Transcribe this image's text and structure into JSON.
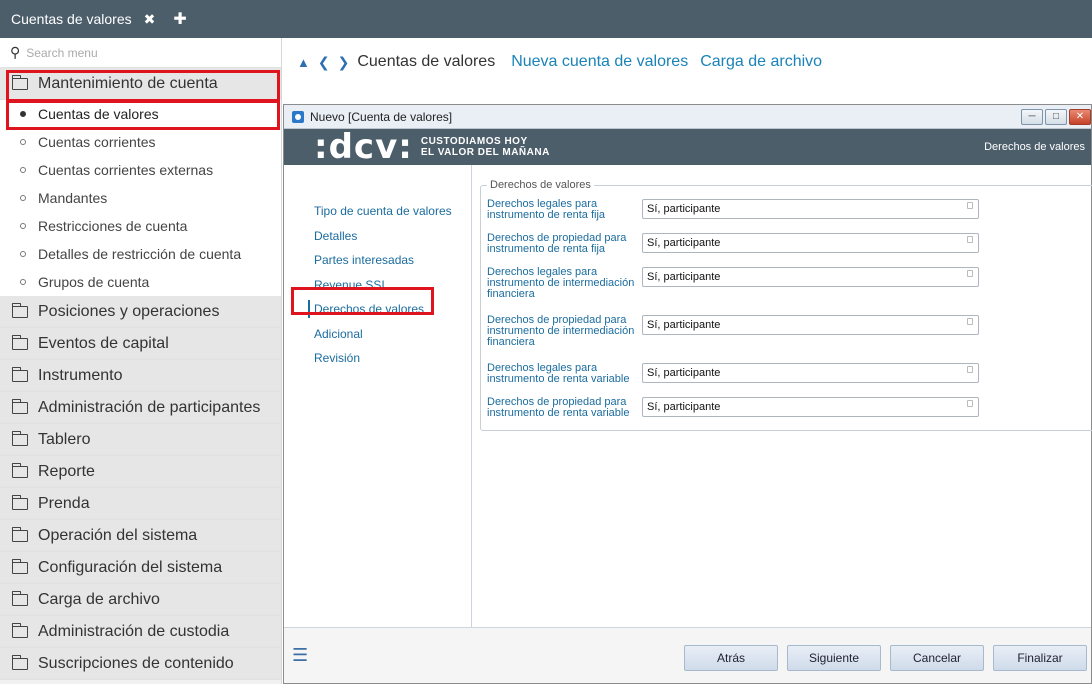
{
  "tabbar": {
    "tab_label": "Cuentas de valores",
    "close_glyph": "✖",
    "add_glyph": "✚"
  },
  "sidebar": {
    "search_placeholder": "Search menu",
    "sections": [
      {
        "label": "Mantenimiento de cuenta",
        "expanded": true
      },
      {
        "label": "Posiciones y operaciones"
      },
      {
        "label": "Eventos de capital"
      },
      {
        "label": "Instrumento"
      },
      {
        "label": "Administración de participantes"
      },
      {
        "label": "Tablero"
      },
      {
        "label": "Reporte"
      },
      {
        "label": "Prenda"
      },
      {
        "label": "Operación del sistema"
      },
      {
        "label": "Configuración del sistema"
      },
      {
        "label": "Carga de archivo"
      },
      {
        "label": "Administración de custodia"
      },
      {
        "label": "Suscripciones de contenido"
      }
    ],
    "subitems": [
      {
        "label": "Cuentas de valores",
        "active": true
      },
      {
        "label": "Cuentas corrientes"
      },
      {
        "label": "Cuentas corrientes externas"
      },
      {
        "label": "Mandantes"
      },
      {
        "label": "Restricciones de cuenta"
      },
      {
        "label": "Detalles de restricción de cuenta"
      },
      {
        "label": "Grupos de cuenta"
      }
    ]
  },
  "header": {
    "title": "Cuentas de valores",
    "link_new": "Nueva cuenta de valores",
    "link_upload": "Carga de archivo"
  },
  "dialog": {
    "title": "Nuevo [Cuenta de valores]",
    "brand_logo": ":dcv:",
    "brand_tag_line1": "CUSTODIAMOS HOY",
    "brand_tag_line2": "EL VALOR DEL MAÑANA",
    "brand_right": "Derechos de valores",
    "nav": [
      {
        "label": "Tipo de cuenta de valores"
      },
      {
        "label": "Detalles"
      },
      {
        "label": "Partes interesadas"
      },
      {
        "label": "Revenue SSI"
      },
      {
        "label": "Derechos de valores",
        "active": true
      },
      {
        "label": "Adicional"
      },
      {
        "label": "Revisión"
      }
    ],
    "fieldset_legend": "Derechos de valores",
    "fields": [
      {
        "label": "Derechos legales para instrumento de renta fija",
        "value": "Sí, participante"
      },
      {
        "label": "Derechos de propiedad para instrumento de renta fija",
        "value": "Sí, participante"
      },
      {
        "label": "Derechos legales para instrumento de intermediación financiera",
        "value": "Sí, participante"
      },
      {
        "label": "Derechos de propiedad para instrumento de intermediación financiera",
        "value": "Sí, participante"
      },
      {
        "label": "Derechos legales para instrumento de renta variable",
        "value": "Sí, participante"
      },
      {
        "label": "Derechos de propiedad para instrumento de renta variable",
        "value": "Sí, participante"
      }
    ],
    "buttons": {
      "back": "Atrás",
      "next": "Siguiente",
      "cancel": "Cancelar",
      "finish": "Finalizar"
    }
  },
  "colors": {
    "highlight": "#e0141e",
    "header_dark": "#4d5e6b",
    "link_blue": "#1b6c9e"
  }
}
